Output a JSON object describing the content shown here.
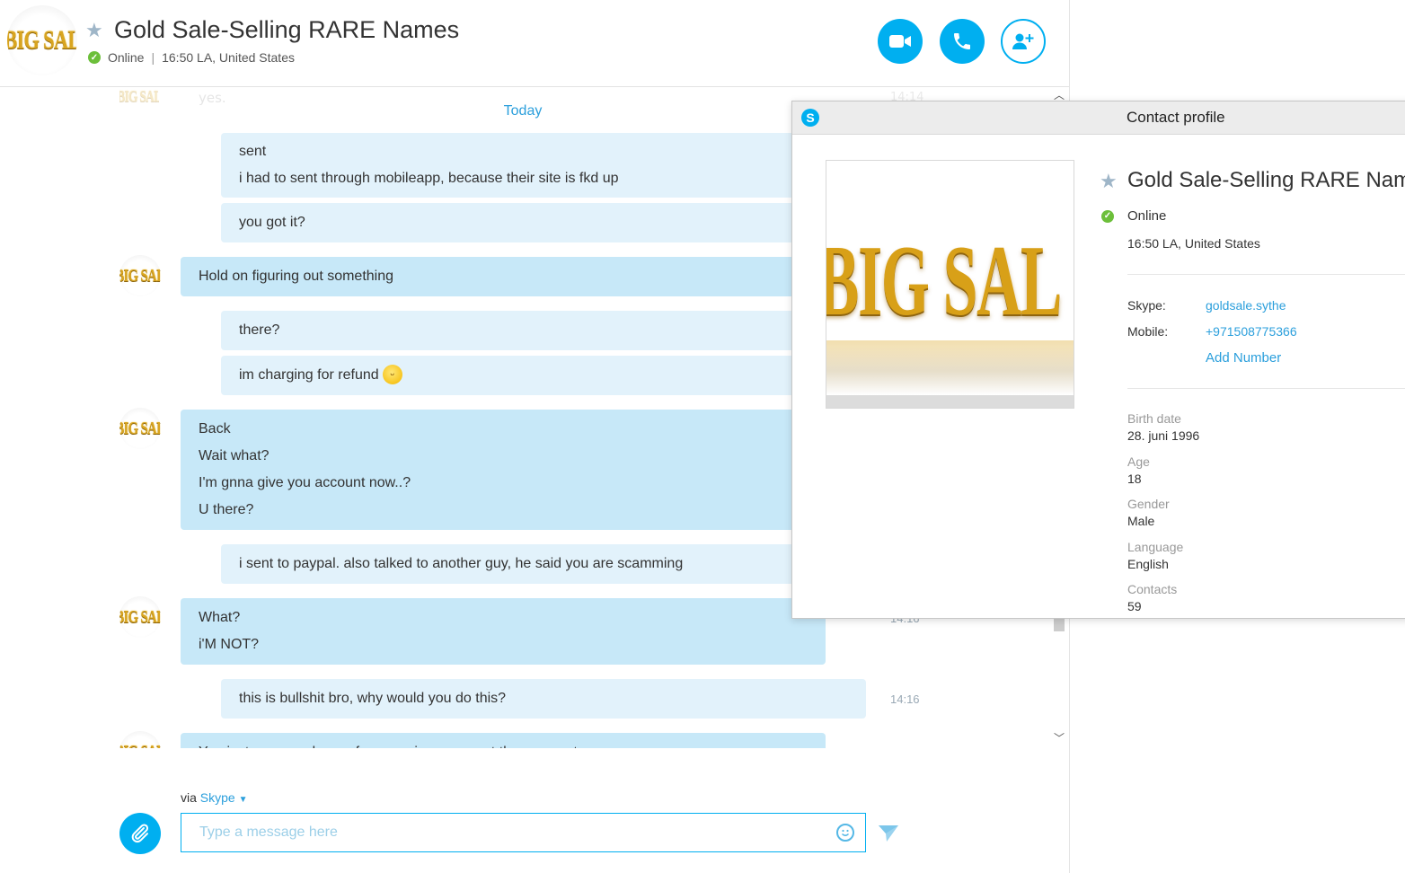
{
  "conversation": {
    "title": "Gold Sale-Selling RARE Names",
    "status": "Online",
    "separator": "|",
    "local_time": "16:50 LA, United States",
    "avatar_text": "BIG SAL"
  },
  "header_buttons": {
    "video_icon": "video-camera-icon",
    "call_icon": "phone-icon",
    "add_icon": "add-person-icon"
  },
  "messages": {
    "faded_previous": {
      "text": "yes.",
      "time": "14:14"
    },
    "day_divider": "Today",
    "items": [
      {
        "sender": "me",
        "lines": [
          "sent",
          "i had to sent through mobileapp, because their site is fkd up"
        ]
      },
      {
        "sender": "me",
        "lines": [
          "you got it?"
        ]
      },
      {
        "sender": "them",
        "lines": [
          "Hold on figuring out something"
        ]
      },
      {
        "sender": "me",
        "lines": [
          "there?"
        ]
      },
      {
        "sender": "me",
        "lines": [
          "im charging for refund"
        ],
        "emoji": "smile"
      },
      {
        "sender": "them",
        "lines": [
          "Back",
          "Wait what?",
          "I'm gnna give you account now..?",
          "U there?"
        ]
      },
      {
        "sender": "me",
        "lines": [
          "i sent to paypal. also talked to another guy, he said you are scamming"
        ]
      },
      {
        "sender": "them",
        "lines": [
          "What?",
          "i'M NOT?"
        ],
        "time": "14:16"
      },
      {
        "sender": "me",
        "lines": [
          "this is bullshit bro, why would you do this?"
        ],
        "time": "14:16"
      },
      {
        "sender": "them",
        "lines": [
          "You just scammed one of my previous account then you act ..."
        ]
      }
    ]
  },
  "composer": {
    "via_prefix": "via",
    "via_service": "Skype",
    "placeholder": "Type a message here"
  },
  "profile": {
    "window_title": "Contact profile",
    "name": "Gold Sale-Selling RARE Names",
    "status": "Online",
    "local_time": "16:50 LA, United States",
    "photo_text": "BIG SAL",
    "skype_label": "Skype:",
    "skype_value": "goldsale.sythe",
    "mobile_label": "Mobile:",
    "mobile_value": "+971508775366",
    "add_number": "Add Number",
    "fields": [
      {
        "label": "Birth date",
        "value": "28. juni 1996"
      },
      {
        "label": "Age",
        "value": "18"
      },
      {
        "label": "Gender",
        "value": "Male"
      },
      {
        "label": "Language",
        "value": "English"
      },
      {
        "label": "Contacts",
        "value": "59"
      }
    ]
  },
  "colors": {
    "accent": "#00aff0",
    "link": "#2b9fdc",
    "bubble_mine": "#e2f2fb",
    "bubble_theirs": "#c7e8f8",
    "online": "#6cbf3a"
  }
}
